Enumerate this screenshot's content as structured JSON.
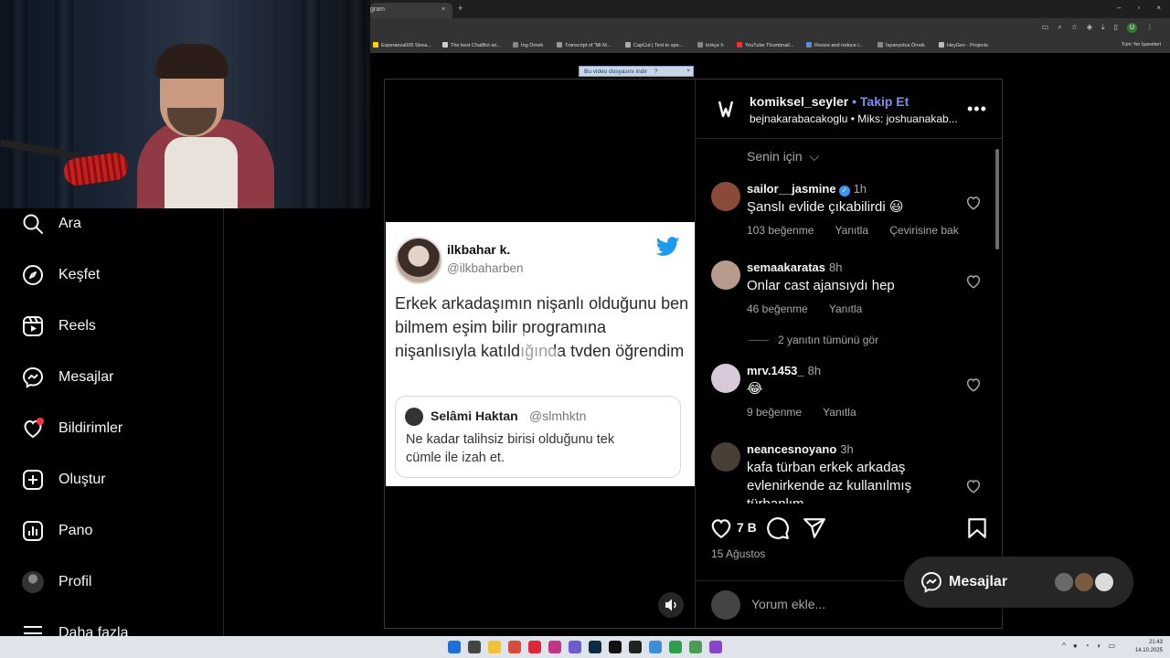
{
  "browser": {
    "tab_title": "gram",
    "tab_close": "×",
    "new_tab": "+",
    "window_controls": [
      "‒",
      "▫",
      "×"
    ],
    "profile_initial": "U",
    "bookmarks": [
      {
        "label": "Esperanza000 Strea...",
        "color": "#ffd400"
      },
      {
        "label": "The best ChatBot an...",
        "color": "#cccccc"
      },
      {
        "label": "İng Örnek",
        "color": "#888888"
      },
      {
        "label": "Transcript of \"Mi M...",
        "color": "#999999"
      },
      {
        "label": "CapCut | Text to spe...",
        "color": "#aaaaaa"
      },
      {
        "label": "türkçe h",
        "color": "#888888"
      },
      {
        "label": "YouTube Thumbnail...",
        "color": "#ff2a2a"
      },
      {
        "label": "Resize and reduce i...",
        "color": "#5b8dd9"
      },
      {
        "label": "İspanyolca Örnek",
        "color": "#888888"
      },
      {
        "label": "HeyGen - Projects",
        "color": "#bbbbbb"
      }
    ],
    "all_bookmarks": "Tüm Yer İşaretleri"
  },
  "download_bar": {
    "label": "Bu video dosyasını indir",
    "help": "?",
    "close": "×"
  },
  "sidebar": {
    "items": [
      {
        "label": "Ara",
        "icon": "search-icon"
      },
      {
        "label": "Keşfet",
        "icon": "compass-icon"
      },
      {
        "label": "Reels",
        "icon": "reels-icon"
      },
      {
        "label": "Mesajlar",
        "icon": "messenger-icon"
      },
      {
        "label": "Bildirimler",
        "icon": "heart-icon"
      },
      {
        "label": "Oluştur",
        "icon": "plus-square-icon"
      },
      {
        "label": "Pano",
        "icon": "dashboard-icon"
      },
      {
        "label": "Profil",
        "icon": "profile-avatar"
      },
      {
        "label": "Daha fazla",
        "icon": "menu-icon"
      }
    ]
  },
  "tweet": {
    "name": "ilkbahar k.",
    "handle": "@ilkbaharben",
    "text": "Erkek arkadaşımın nişanlı olduğunu ben bilmem eşim bilir programına nişanlısıyla katıldığında tvden öğrendim",
    "quote": {
      "name": "Selâmi Haktan",
      "handle": "@slmhktn",
      "text": "Ne kadar talihsiz birisi olduğunu tek cümle ile izah et."
    }
  },
  "post": {
    "account": "komiksel_seyler",
    "follow_separator": "•",
    "follow_label": "Takip Et",
    "subtitle": "bejnakarabacakoglu • Miks: joshuanakab...",
    "more": "•••",
    "sort_label": "Senin için",
    "comments": [
      {
        "user": "sailor__jasmine",
        "verified": true,
        "time": "1h",
        "text": "Şanslı evlide çıkabilirdi 😃",
        "likes": "103 beğenme",
        "reply": "Yanıtla",
        "translate": "Çevirisine bak",
        "avatar_color": "#8a4a3a"
      },
      {
        "user": "semaakaratas",
        "verified": false,
        "time": "8h",
        "text": "Onlar cast ajansıydı hep",
        "likes": "46 beğenme",
        "reply": "Yanıtla",
        "translate": "",
        "avatar_color": "#b79c8e"
      },
      {
        "user": "mrv.1453_",
        "verified": false,
        "time": "8h",
        "text": "😂",
        "likes": "9 beğenme",
        "reply": "Yanıtla",
        "translate": "",
        "avatar_color": "#d7c9d9"
      },
      {
        "user": "neancesnoyano",
        "verified": false,
        "time": "3h",
        "text": "kafa türban erkek arkadaş evlenirkende az kullanılmış türbanlım",
        "likes": "",
        "reply": "",
        "translate": "",
        "avatar_color": "#4a3f35"
      }
    ],
    "view_replies": "2 yanıtın tümünü gör",
    "like_count": "7 B",
    "date": "15 Ağustos",
    "add_comment_placeholder": "Yorum ekle..."
  },
  "messages_pill": {
    "label": "Mesajlar"
  },
  "taskbar": {
    "tray": "^",
    "clock_time": "21:43",
    "clock_date": "14.10.2025"
  },
  "colors": {
    "accent_follow": "#7c8ef7",
    "notification_dot": "#ff3040",
    "verified": "#3897f0",
    "twitter_blue": "#1d9bf0"
  }
}
